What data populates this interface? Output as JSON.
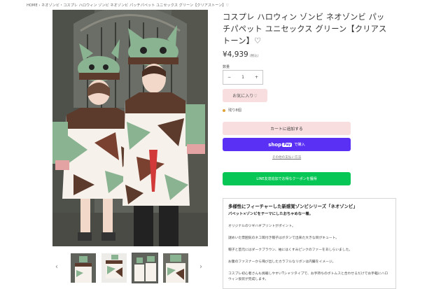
{
  "breadcrumb": "HOME › ネオゾンビ・コスプレ ハロウィン ゾンビ ネオゾンビ パッチパペット ユニセックス グリーン【クリアストーン】♡",
  "product": {
    "title": "コスプレ ハロウィン ゾンビ ネオゾンビ パッチパペット ユニセックス グリーン【クリアストーン】♡",
    "price": "¥4,939",
    "tax_note": "(税込)"
  },
  "quantity": {
    "label": "数量",
    "minus": "−",
    "value": "1",
    "plus": "+"
  },
  "favorite_label": "お気に入り♡",
  "stock_text": "残り8個",
  "add_to_cart_label": "カートに追加する",
  "shop_pay": {
    "shop": "shop",
    "pay": "Pay",
    "buy": "で購入"
  },
  "more_payment_label": "その他の支払い方法",
  "line_coupon_label": "LINE友達追加でお得なクーポンを獲得",
  "thumbnail_nav": {
    "prev": "‹",
    "next": "›"
  },
  "description": {
    "heading": "多様性にフィーチャーした新感覚ゾンビシリーズ「ネオゾンビ」",
    "subheading": "パペット×ゾンビをテーマにしたおちゃめな一着。",
    "paragraphs": [
      "オリジナルのツギハギプリントがポイント。",
      "謎めいた雰囲気のネコ耳付き帽子はボタンで出来た大きな目がキュート。",
      "帽子と首元にはダークブラウン、袖にはくすみピンクのファーをあしらいました。",
      "お腹のファスナーから飛び出したカラフルなリボンは内臓をイメージ。",
      "コスプレ初心者さんも挑戦しやすいTシャツタイプで、お手持ちのボトムスと合わせるだけでお手軽にハロウィン仮装が完成します。"
    ]
  },
  "colors": {
    "accent_pink": "#f8dede",
    "shop_pay": "#5a31f4",
    "line_green": "#06c755"
  }
}
